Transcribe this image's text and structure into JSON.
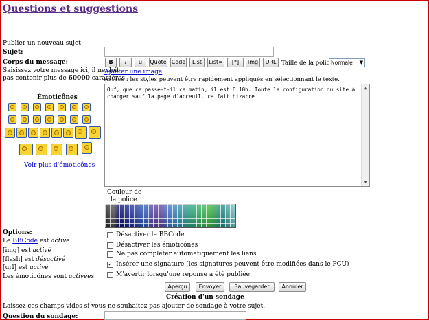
{
  "page": {
    "title": "Questions et suggestions",
    "publish_label": "Publier un nouveau sujet"
  },
  "form": {
    "subject_label": "Sujet:",
    "body_label": "Corps du message:",
    "body_help_1": "Saisissez votre message ici, il ne doit",
    "body_help_2": "pas contenir plus de",
    "max_chars": "60000",
    "body_help_3": "caractères.",
    "message": "Ouf, que ce passe-t-il ce matin, il est 6.10h. Toute le configuration du site à changer sauf la page d'acceuil. ca fait bizarre"
  },
  "toolbar": {
    "bold": "B",
    "italic": "i",
    "underline": "u",
    "quote": "Quote",
    "code": "Code",
    "list": "List",
    "list_ordered": "List=",
    "list_item": "[*]",
    "img": "Img",
    "url": "URL",
    "font_size_label": "Taille de la police:",
    "font_size_value": "Normale",
    "add_image": "Ajouter une image",
    "tip": "Astuce : les styles peuvent être rapidement appliqués en sélectionnant le texte."
  },
  "emoticons": {
    "title": "Émoticônes",
    "more_link": "Voir plus d'émoticônes",
    "icons": [
      "very-happy",
      "smile",
      "wink",
      "sad",
      "surprised",
      "shocked",
      "confused",
      "cool",
      "laughing",
      "mad",
      "razz",
      "embarrassed",
      "crying",
      "evil",
      "twisted",
      "rolling-eyes",
      "cat",
      "arrow",
      "idea",
      "question",
      "exclamation",
      "neutral",
      "mr-green",
      "smirk"
    ]
  },
  "color": {
    "label_1": "Couleur de",
    "label_2": "la police"
  },
  "options": {
    "title": "Options:",
    "bbcode_prefix": "Le",
    "bbcode_link": "BBCode",
    "bbcode_mid": "est",
    "bbcode_state": "activé",
    "img_prefix": "[img] est",
    "img_state": "activé",
    "flash_prefix": "[flash] est",
    "flash_state": "désactivé",
    "url_prefix": "[url] est",
    "url_state": "activé",
    "emo_prefix": "Les émoticônes sont",
    "emo_state": "activées",
    "checkboxes": [
      {
        "label": "Désactiver le BBCode",
        "checked": false
      },
      {
        "label": "Désactiver les émoticônes",
        "checked": false
      },
      {
        "label": "Ne pas compléter automatiquement les liens",
        "checked": false
      },
      {
        "label": "Insérer une signature (les signatures peuvent être modifiées dans le PCU)",
        "checked": true
      },
      {
        "label": "M'avertir lorsqu'une réponse a été publiée",
        "checked": false
      }
    ]
  },
  "actions": {
    "preview": "Aperçu",
    "send": "Envoyer",
    "save": "Sauvegarder",
    "cancel": "Annuler"
  },
  "poll": {
    "title": "Création d'un sondage",
    "help": "Laissez ces champs vides si vous ne souhaitez pas ajouter de sondage à votre sujet.",
    "question_label": "Question du sondage:"
  },
  "colors": {
    "title": "#5b2a86",
    "link": "#0000cc",
    "frame": "#cc0000"
  }
}
